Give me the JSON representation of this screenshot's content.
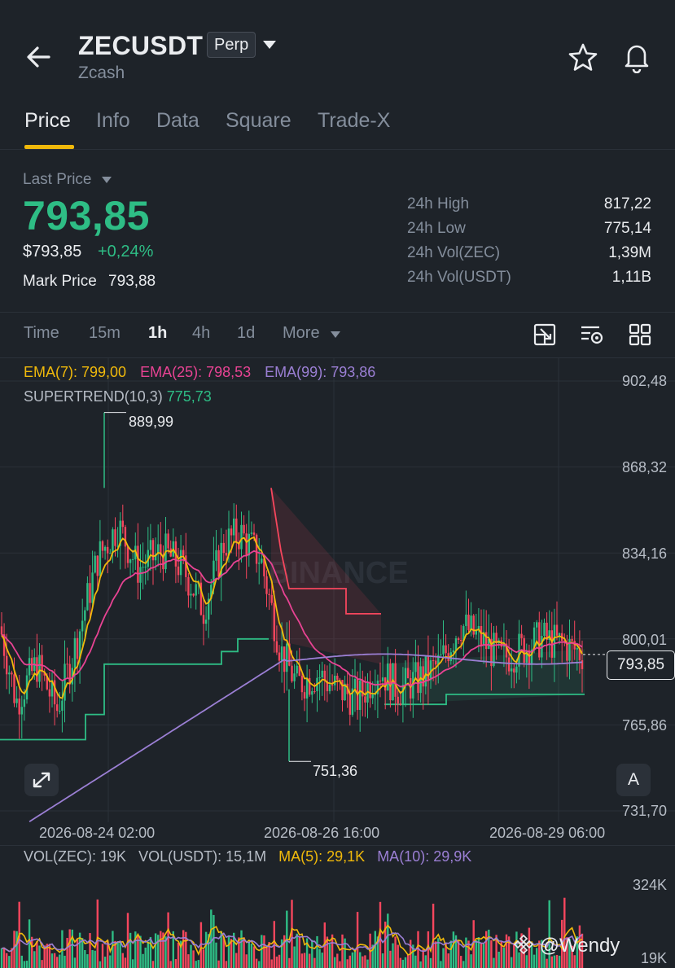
{
  "header": {
    "title": "ZECUSDT",
    "badge": "Perp",
    "subtitle": "Zcash"
  },
  "tabs": [
    "Price",
    "Info",
    "Data",
    "Square",
    "Trade-X"
  ],
  "ticker": {
    "last_price_label": "Last Price",
    "last_price": "793,85",
    "usd_price": "$793,85",
    "change": "+0,24%",
    "mark_label": "Mark Price",
    "mark_value": "793,88",
    "stats": [
      {
        "label": "24h High",
        "value": "817,22"
      },
      {
        "label": "24h Low",
        "value": "775,14"
      },
      {
        "label": "24h Vol(ZEC)",
        "value": "1,39M"
      },
      {
        "label": "24h Vol(USDT)",
        "value": "1,11B"
      }
    ]
  },
  "timeframes": [
    "Time",
    "15m",
    "1h",
    "4h",
    "1d",
    "More"
  ],
  "active_timeframe": "1h",
  "indicators": {
    "ema7": "EMA(7): 799,00",
    "ema25": "EMA(25): 798,53",
    "ema99": "EMA(99): 793,86",
    "supertrend_label": "SUPERTREND(10,3)",
    "supertrend_value": "775,73"
  },
  "volume_indicators": {
    "vol_zec": "VOL(ZEC): 19K",
    "vol_usdt": "VOL(USDT): 15,1M",
    "ma5": "MA(5): 29,1K",
    "ma10": "MA(10): 29,9K"
  },
  "chart": {
    "y_labels": [
      "902,48",
      "868,32",
      "834,16",
      "800,01",
      "765,86",
      "731,70"
    ],
    "x_labels": [
      "2026-08-24 02:00",
      "2026-08-26 16:00",
      "2026-08-29 06:00"
    ],
    "high_label": "889,99",
    "low_label": "751,36",
    "current_price": "793,85",
    "vol_y_labels": [
      "324K",
      "19K"
    ],
    "watermark": "BINANCE",
    "auto_label": "A"
  },
  "footer_watermark": "@Wendy",
  "colors": {
    "up": "#2ebd85",
    "down": "#f6465d",
    "ema7": "#f0b90b",
    "ema25": "#e84393",
    "ema99": "#9b7fd4",
    "accent": "#f0b90b",
    "bg": "#1e2329"
  }
}
